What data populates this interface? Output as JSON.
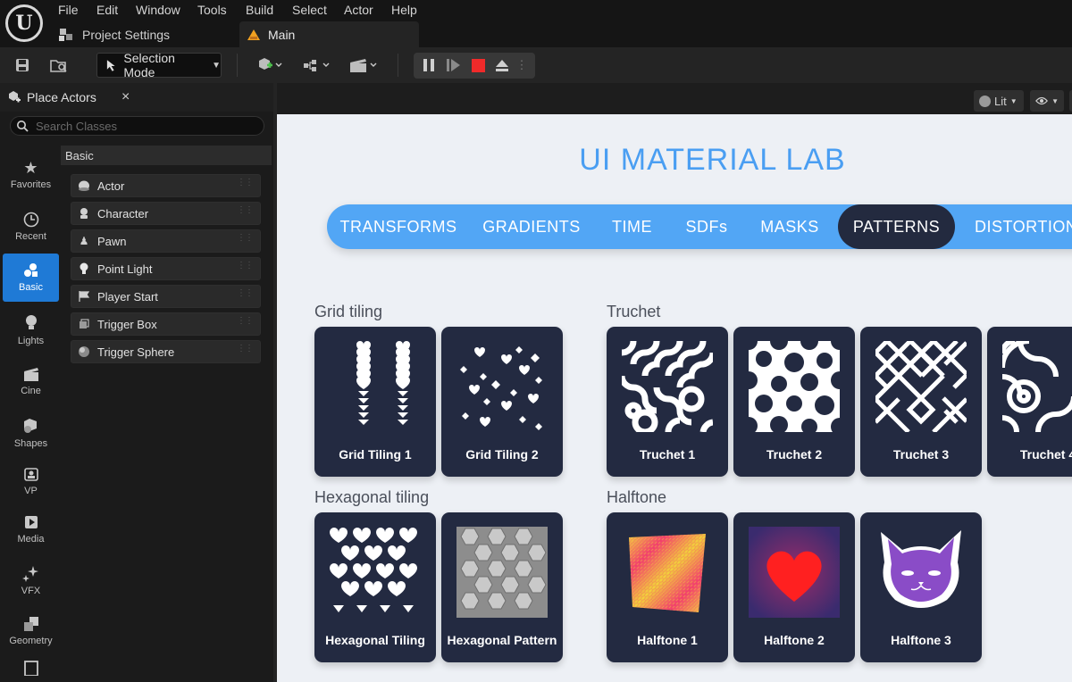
{
  "menubar": {
    "items": [
      "File",
      "Edit",
      "Window",
      "Tools",
      "Build",
      "Select",
      "Actor",
      "Help"
    ],
    "tabs": {
      "project_settings": "Project Settings",
      "main": "Main"
    }
  },
  "toolbar": {
    "selection_mode": "Selection Mode"
  },
  "place_actors": {
    "title": "Place Actors",
    "close": "×",
    "search_placeholder": "Search Classes",
    "categories": [
      {
        "label": "Favorites",
        "icon": "star-icon"
      },
      {
        "label": "Recent",
        "icon": "clock-icon"
      },
      {
        "label": "Basic",
        "icon": "shapes-icon"
      },
      {
        "label": "Lights",
        "icon": "bulb-icon"
      },
      {
        "label": "Cine",
        "icon": "clapper-icon"
      },
      {
        "label": "Shapes",
        "icon": "cube-icon"
      },
      {
        "label": "VP",
        "icon": "vp-icon"
      },
      {
        "label": "Media",
        "icon": "media-icon"
      },
      {
        "label": "VFX",
        "icon": "sparkle-icon"
      },
      {
        "label": "Geometry",
        "icon": "geometry-icon"
      }
    ],
    "selected_category": "Basic",
    "list_header": "Basic",
    "actors": [
      "Actor",
      "Character",
      "Pawn",
      "Point Light",
      "Player Start",
      "Trigger Box",
      "Trigger Sphere"
    ]
  },
  "viewport": {
    "lit": "Lit"
  },
  "lab": {
    "title": "UI MATERIAL LAB",
    "tabs": [
      "TRANSFORMS",
      "GRADIENTS",
      "TIME",
      "SDFs",
      "MASKS",
      "PATTERNS",
      "DISTORTIONS"
    ],
    "active_tab": "PATTERNS",
    "sections": {
      "grid": {
        "title": "Grid tiling",
        "cards": [
          "Grid Tiling 1",
          "Grid Tiling 2"
        ]
      },
      "truchet": {
        "title": "Truchet",
        "cards": [
          "Truchet 1",
          "Truchet 2",
          "Truchet 3",
          "Truchet 4"
        ]
      },
      "hex": {
        "title": "Hexagonal tiling",
        "cards": [
          "Hexagonal Tiling",
          "Hexagonal Pattern"
        ]
      },
      "halftone": {
        "title": "Halftone",
        "cards": [
          "Halftone 1",
          "Halftone 2",
          "Halftone 3"
        ]
      }
    }
  }
}
